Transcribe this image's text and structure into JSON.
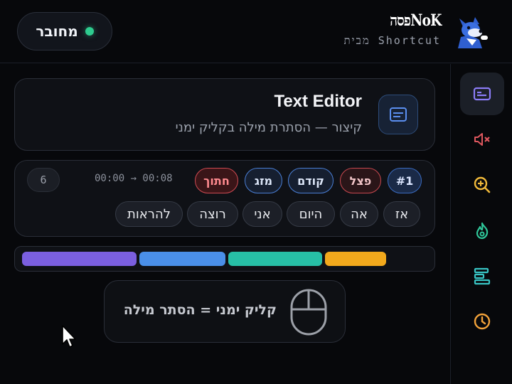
{
  "header": {
    "status_label": "מחובר",
    "brand_logo": "NoKפסה",
    "brand_sub": "מבית Shortcut"
  },
  "rail": {
    "items": [
      {
        "icon": "subtitles-icon",
        "color": "#8b7cf6",
        "active": true
      },
      {
        "icon": "mute-icon",
        "color": "#e0585f",
        "active": false
      },
      {
        "icon": "zoom-in-icon",
        "color": "#f0b93a",
        "active": false
      },
      {
        "icon": "flame-icon",
        "color": "#2fc79a",
        "active": false
      },
      {
        "icon": "align-left-icon",
        "color": "#38c4c4",
        "active": false
      },
      {
        "icon": "clock-icon",
        "color": "#f2a23a",
        "active": false
      }
    ]
  },
  "title_card": {
    "title": "Text Editor",
    "subtitle": "קיצור — הסתרת מילה בקליק ימני"
  },
  "segment": {
    "index": "#1",
    "actions": {
      "split": "פצל",
      "previous": "קודם",
      "merge": "מזג",
      "cut": "חתוך"
    },
    "timecode": "00:00 → 00:08",
    "word_count": "6",
    "words": [
      "אז",
      "אה",
      "היום",
      "אני",
      "רוצה",
      "להראות"
    ]
  },
  "timeline": {
    "segments": [
      {
        "color": "#7b5fe0",
        "fraction": 0.28
      },
      {
        "color": "#4a8fe8",
        "fraction": 0.21
      },
      {
        "color": "#27bfa6",
        "fraction": 0.23
      },
      {
        "color": "#f2a91c",
        "fraction": 0.15
      }
    ]
  },
  "hint": {
    "text": "קליק ימני = הסתר מילה"
  }
}
